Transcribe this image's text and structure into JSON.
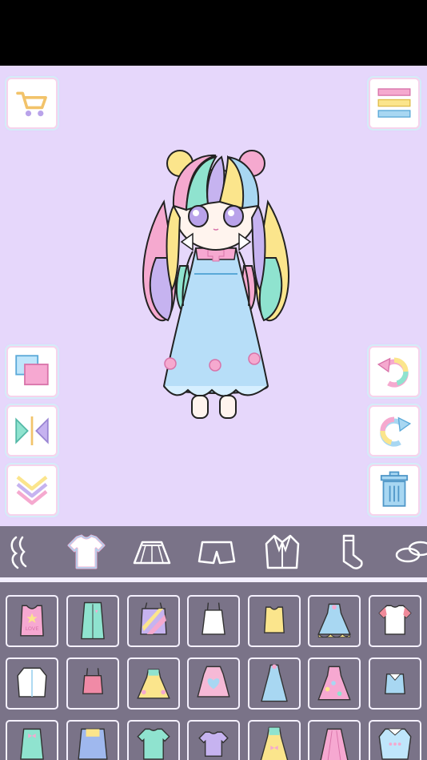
{
  "toolbar_left": [
    "shop-cart-icon",
    "layers-icon",
    "flip-icon",
    "move-down-icon"
  ],
  "toolbar_right": [
    "menu-icon",
    "undo-icon",
    "redo-icon",
    "trash-icon"
  ],
  "tabs": [
    "hair-icon",
    "top-icon",
    "skirt-icon",
    "shorts-icon",
    "jacket-icon",
    "socks-icon",
    "shoes-icon"
  ],
  "selected_tab": "top-icon",
  "items": [
    {
      "name": "item-pink-tank-love",
      "label": "LOVE"
    },
    {
      "name": "item-mint-long-vest",
      "label": ""
    },
    {
      "name": "item-rainbow-camisole",
      "label": ""
    },
    {
      "name": "item-white-camisole",
      "label": ""
    },
    {
      "name": "item-yellow-tank",
      "label": ""
    },
    {
      "name": "item-blue-frill-dress",
      "label": ""
    },
    {
      "name": "item-white-red-tee",
      "label": ""
    },
    {
      "name": "item-white-shirt",
      "label": ""
    },
    {
      "name": "item-pink-camisole",
      "label": ""
    },
    {
      "name": "item-yellow-sundress",
      "label": ""
    },
    {
      "name": "item-pink-heart-dress",
      "label": ""
    },
    {
      "name": "item-blue-long-dress",
      "label": ""
    },
    {
      "name": "item-pink-floral-dress",
      "label": ""
    },
    {
      "name": "item-blue-sailor-top",
      "label": ""
    },
    {
      "name": "item-mint-ribbon-dress",
      "label": ""
    },
    {
      "name": "item-blue-pinafore",
      "label": ""
    },
    {
      "name": "item-mint-tee",
      "label": ""
    },
    {
      "name": "item-purple-tee",
      "label": ""
    },
    {
      "name": "item-yellow-bow-dress",
      "label": ""
    },
    {
      "name": "item-pink-long-skirt",
      "label": ""
    },
    {
      "name": "item-blue-collar-shirt",
      "label": ""
    }
  ],
  "colors": {
    "stage_background": "#e6d7fb",
    "panel": "#7a7388",
    "pink": "#f5a9cf",
    "mint": "#8fe3cf",
    "blue": "#a8d7f2",
    "yellow": "#fbe58c",
    "lavender": "#c6b3f0"
  }
}
